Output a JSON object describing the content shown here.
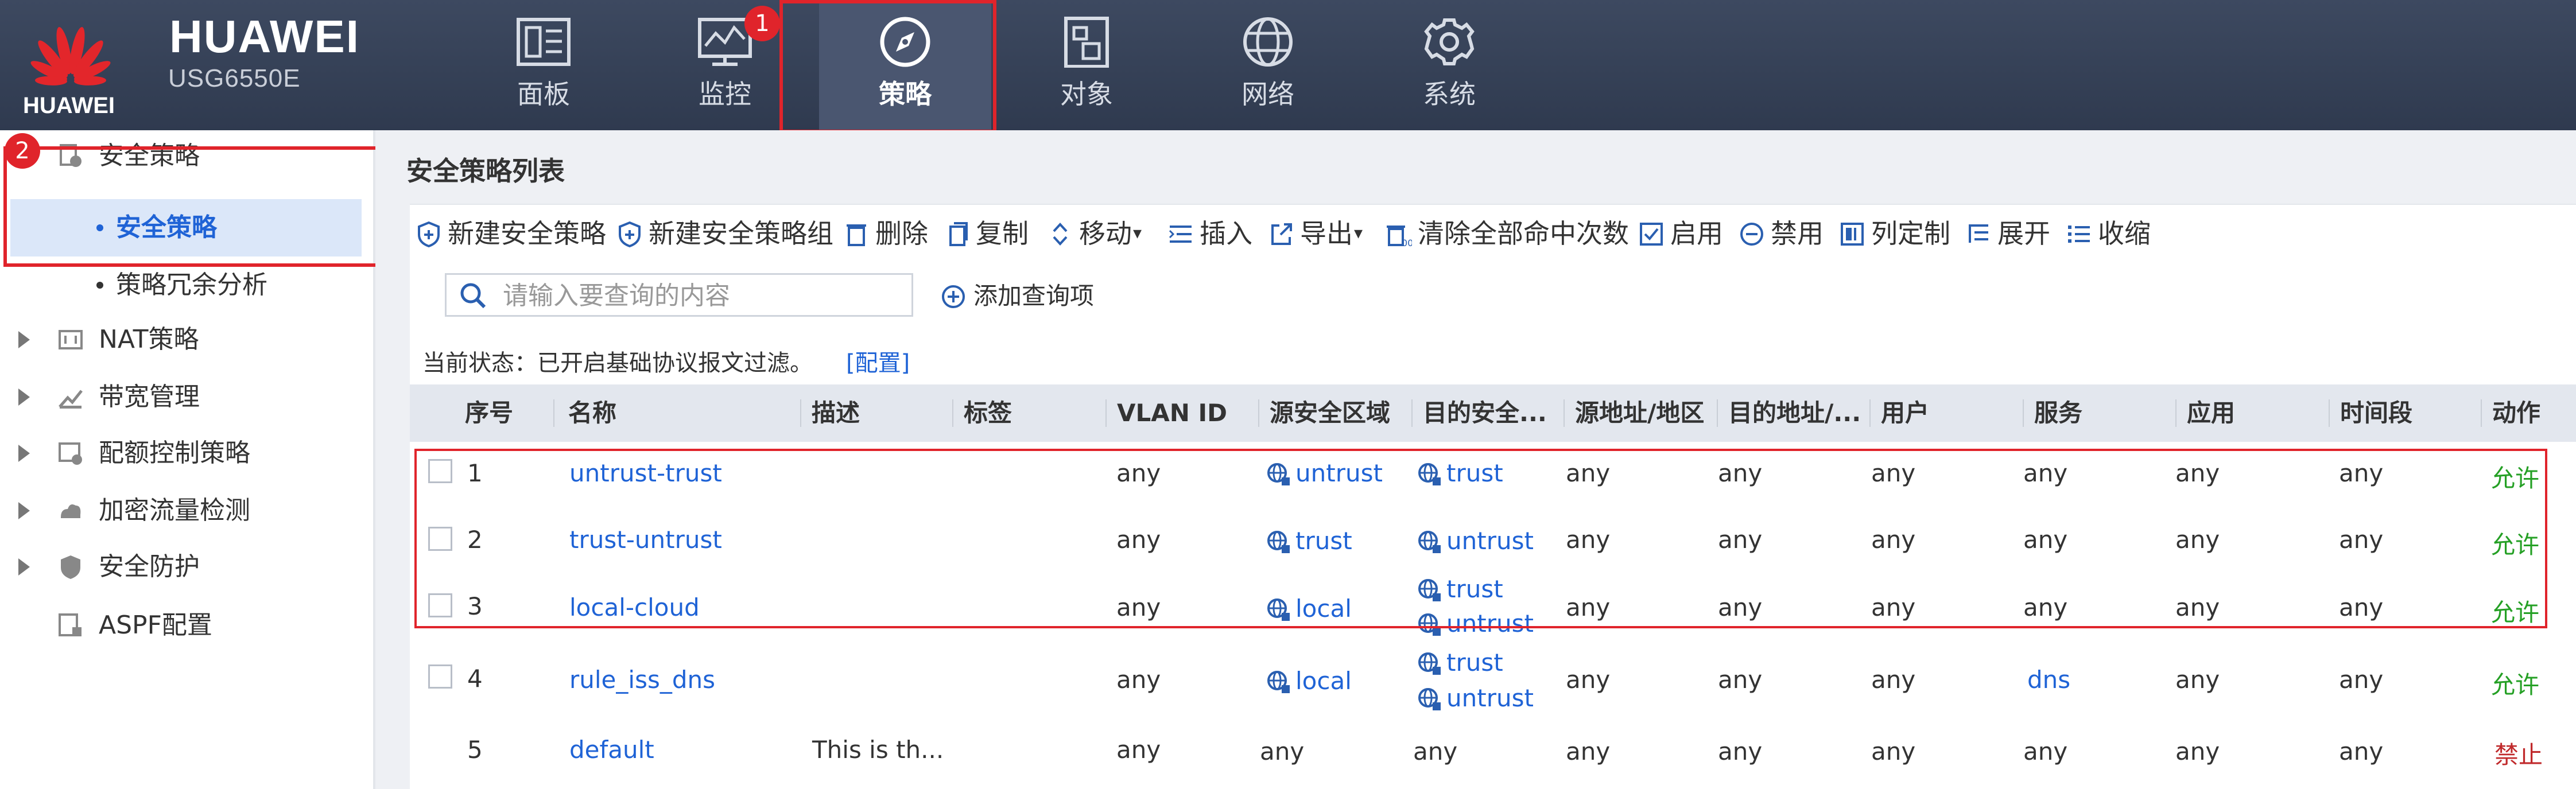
{
  "brand": {
    "name": "HUAWEI",
    "model": "USG6550E",
    "logo_text": "HUAWEI"
  },
  "nav": [
    {
      "label": "面板",
      "icon": "dashboard-icon"
    },
    {
      "label": "监控",
      "icon": "monitor-icon"
    },
    {
      "label": "策略",
      "icon": "compass-icon",
      "active": true
    },
    {
      "label": "对象",
      "icon": "object-icon"
    },
    {
      "label": "网络",
      "icon": "globe-icon"
    },
    {
      "label": "系统",
      "icon": "gear-icon"
    }
  ],
  "badges": {
    "one": "1",
    "two": "2"
  },
  "sidebar": {
    "items": [
      {
        "label": "安全策略",
        "icon": "security-policy-icon"
      },
      {
        "label": "NAT策略",
        "icon": "nat-icon"
      },
      {
        "label": "带宽管理",
        "icon": "bandwidth-icon"
      },
      {
        "label": "配额控制策略",
        "icon": "quota-icon"
      },
      {
        "label": "加密流量检测",
        "icon": "encrypted-traffic-icon"
      },
      {
        "label": "安全防护",
        "icon": "shield-icon"
      },
      {
        "label": "ASPF配置",
        "icon": "aspf-icon"
      }
    ],
    "sub_items": [
      {
        "label": "安全策略",
        "selected": true
      },
      {
        "label": "策略冗余分析"
      }
    ]
  },
  "page": {
    "title": "安全策略列表"
  },
  "toolbar": {
    "new_policy": "新建安全策略",
    "new_group": "新建安全策略组",
    "delete": "删除",
    "copy": "复制",
    "move": "移动",
    "insert": "插入",
    "export": "导出",
    "clear_hits": "清除全部命中次数",
    "enable": "启用",
    "disable": "禁用",
    "customize_columns": "列定制",
    "expand": "展开",
    "collapse": "收缩"
  },
  "search": {
    "placeholder": "请输入要查询的内容",
    "add_query": "添加查询项"
  },
  "status": {
    "text": "当前状态：已开启基础协议报文过滤。",
    "link": "[配置]"
  },
  "table": {
    "headers": [
      "序号",
      "名称",
      "描述",
      "标签",
      "VLAN ID",
      "源安全区域",
      "目的安全...",
      "源地址/地区",
      "目的地址/...",
      "用户",
      "服务",
      "应用",
      "时间段",
      "动作"
    ],
    "rows": [
      {
        "no": "1",
        "name": "untrust-trust",
        "desc": "",
        "tag": "",
        "vlan": "any",
        "src_zone": [
          "untrust"
        ],
        "dst_zone": [
          "trust"
        ],
        "src_addr": "any",
        "dst_addr": "any",
        "user": "any",
        "service": "any",
        "app": "any",
        "time": "any",
        "action": "允许"
      },
      {
        "no": "2",
        "name": "trust-untrust",
        "desc": "",
        "tag": "",
        "vlan": "any",
        "src_zone": [
          "trust"
        ],
        "dst_zone": [
          "untrust"
        ],
        "src_addr": "any",
        "dst_addr": "any",
        "user": "any",
        "service": "any",
        "app": "any",
        "time": "any",
        "action": "允许"
      },
      {
        "no": "3",
        "name": "local-cloud",
        "desc": "",
        "tag": "",
        "vlan": "any",
        "src_zone": [
          "local"
        ],
        "dst_zone": [
          "trust",
          "untrust"
        ],
        "src_addr": "any",
        "dst_addr": "any",
        "user": "any",
        "service": "any",
        "app": "any",
        "time": "any",
        "action": "允许"
      },
      {
        "no": "4",
        "name": "rule_iss_dns",
        "desc": "",
        "tag": "",
        "vlan": "any",
        "src_zone": [
          "local"
        ],
        "dst_zone": [
          "trust",
          "untrust"
        ],
        "src_addr": "any",
        "dst_addr": "any",
        "user": "any",
        "service": "dns",
        "app": "any",
        "time": "any",
        "action": "允许"
      },
      {
        "no": "5",
        "name": "default",
        "desc": "This is th...",
        "tag": "",
        "vlan": "any",
        "src_zone_text": "any",
        "dst_zone_text": "any",
        "src_addr": "any",
        "dst_addr": "any",
        "user": "any",
        "service": "any",
        "app": "any",
        "time": "any",
        "action": "禁止"
      }
    ]
  },
  "colors": {
    "accent": "#1f63d6",
    "allow": "#25a025",
    "deny": "#c0292b",
    "highlight": "#e0242b",
    "topbar": "#36415a"
  }
}
